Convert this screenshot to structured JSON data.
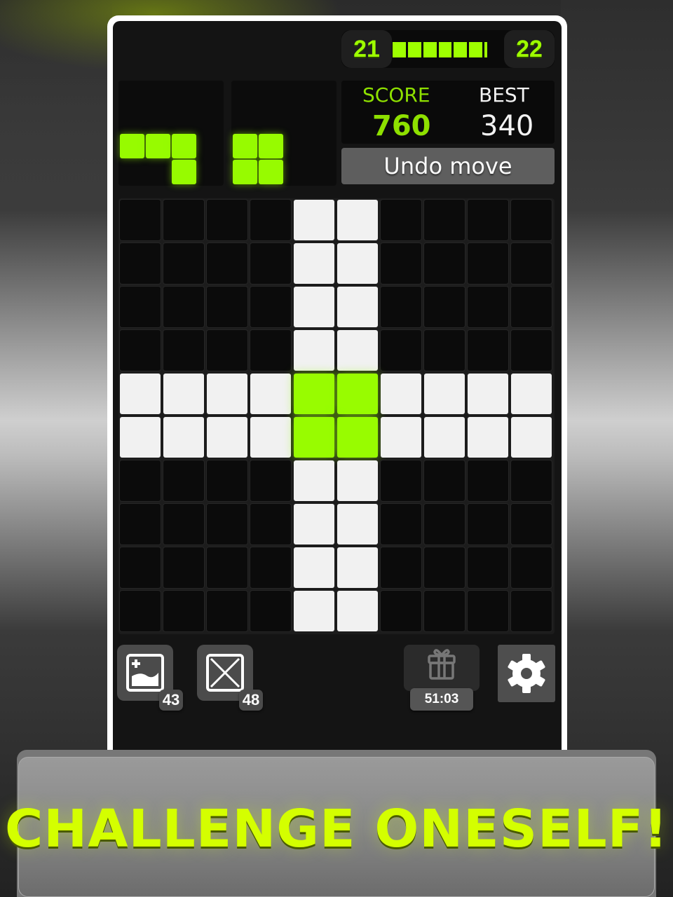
{
  "level": {
    "current": "21",
    "next": "22",
    "progress_fraction": 0.9,
    "progress_segments_total": 7
  },
  "pieces": [
    {
      "name": "l-piece",
      "cells": [
        [
          0,
          0
        ],
        [
          0,
          1
        ],
        [
          0,
          2
        ],
        [
          1,
          2
        ]
      ]
    },
    {
      "name": "square-piece",
      "cells": [
        [
          0,
          0
        ],
        [
          0,
          1
        ],
        [
          1,
          0
        ],
        [
          1,
          1
        ]
      ]
    }
  ],
  "score": {
    "label": "SCORE",
    "value": "760",
    "best_label": "BEST",
    "best_value": "340"
  },
  "undo": {
    "label": "Undo move"
  },
  "board": {
    "size": 10,
    "filled_cols": [
      4,
      5
    ],
    "filled_rows": [
      4,
      5
    ],
    "highlight": "green intersection of filled rows and columns"
  },
  "tools": [
    {
      "name": "add-image",
      "count": "43"
    },
    {
      "name": "clear",
      "count": "48"
    }
  ],
  "gift": {
    "timer": "51:03"
  },
  "banner": {
    "text": "CHALLENGE ONESELF!"
  },
  "colors": {
    "accent": "#9eff00",
    "banner_text": "#d4ff00"
  }
}
